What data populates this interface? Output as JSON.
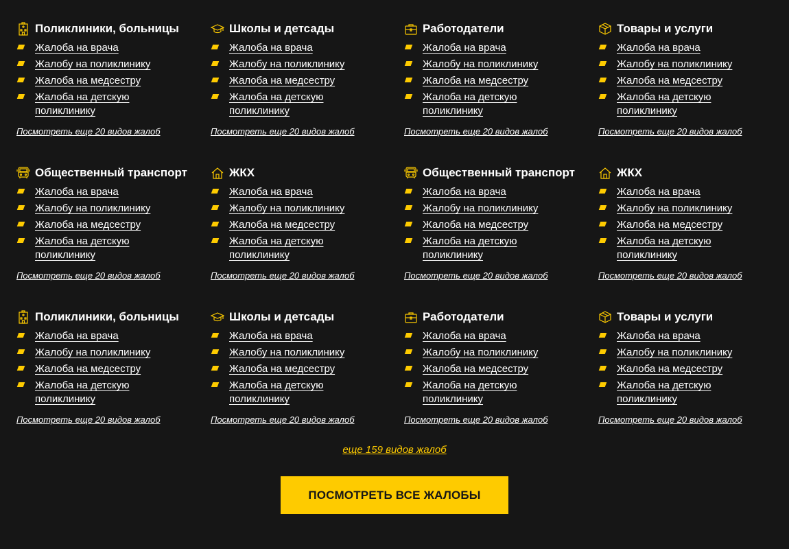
{
  "categories": [
    {
      "title": "Поликлиники, больницы",
      "icon": "hospital-icon",
      "items": [
        "Жалоба на врача",
        "Жалобу на поликлинику",
        "Жалоба на медсестру",
        "Жалоба на детскую поликлинику"
      ],
      "more": "Посмотреть еще 20 видов жалоб"
    },
    {
      "title": "Школы и детсады",
      "icon": "graduation-cap-icon",
      "items": [
        "Жалоба на врача",
        "Жалобу на поликлинику",
        "Жалоба на медсестру",
        "Жалоба на детскую поликлинику"
      ],
      "more": "Посмотреть еще 20 видов жалоб"
    },
    {
      "title": "Работодатели",
      "icon": "briefcase-icon",
      "items": [
        "Жалоба на врача",
        "Жалобу на поликлинику",
        "Жалоба на медсестру",
        "Жалоба на детскую поликлинику"
      ],
      "more": "Посмотреть еще 20 видов жалоб"
    },
    {
      "title": "Товары и услуги",
      "icon": "box-icon",
      "items": [
        "Жалоба на врача",
        "Жалобу на поликлинику",
        "Жалоба на медсестру",
        "Жалоба на детскую поликлинику"
      ],
      "more": "Посмотреть еще 20 видов жалоб"
    },
    {
      "title": "Общественный транспорт",
      "icon": "bus-icon",
      "items": [
        "Жалоба на врача",
        "Жалобу на поликлинику",
        "Жалоба на медсестру",
        "Жалоба на детскую поликлинику"
      ],
      "more": "Посмотреть еще 20 видов жалоб"
    },
    {
      "title": "ЖКХ",
      "icon": "house-icon",
      "items": [
        "Жалоба на врача",
        "Жалобу на поликлинику",
        "Жалоба на медсестру",
        "Жалоба на детскую поликлинику"
      ],
      "more": "Посмотреть еще 20 видов жалоб"
    },
    {
      "title": "Общественный транспорт",
      "icon": "bus-icon",
      "items": [
        "Жалоба на врача",
        "Жалобу на поликлинику",
        "Жалоба на медсестру",
        "Жалоба на детскую поликлинику"
      ],
      "more": "Посмотреть еще 20 видов жалоб"
    },
    {
      "title": "ЖКХ",
      "icon": "house-icon",
      "items": [
        "Жалоба на врача",
        "Жалобу на поликлинику",
        "Жалоба на медсестру",
        "Жалоба на детскую поликлинику"
      ],
      "more": "Посмотреть еще 20 видов жалоб"
    },
    {
      "title": "Поликлиники, больницы",
      "icon": "hospital-icon",
      "items": [
        "Жалоба на врача",
        "Жалобу на поликлинику",
        "Жалоба на медсестру",
        "Жалоба на детскую поликлинику"
      ],
      "more": "Посмотреть еще 20 видов жалоб"
    },
    {
      "title": "Школы и детсады",
      "icon": "graduation-cap-icon",
      "items": [
        "Жалоба на врача",
        "Жалобу на поликлинику",
        "Жалоба на медсестру",
        "Жалоба на детскую поликлинику"
      ],
      "more": "Посмотреть еще 20 видов жалоб"
    },
    {
      "title": "Работодатели",
      "icon": "briefcase-icon",
      "items": [
        "Жалоба на врача",
        "Жалобу на поликлинику",
        "Жалоба на медсестру",
        "Жалоба на детскую поликлинику"
      ],
      "more": "Посмотреть еще 20 видов жалоб"
    },
    {
      "title": "Товары и услуги",
      "icon": "box-icon",
      "items": [
        "Жалоба на врача",
        "Жалобу на поликлинику",
        "Жалоба на медсестру",
        "Жалоба на детскую поликлинику"
      ],
      "more": "Посмотреть еще 20 видов жалоб"
    }
  ],
  "more_count_link": "еще 159 видов жалоб",
  "cta_label": "ПОСМОТРЕТЬ ВСЕ ЖАЛОБЫ",
  "colors": {
    "background": "#161616",
    "accent": "#fecb00",
    "text": "#ffffff"
  }
}
